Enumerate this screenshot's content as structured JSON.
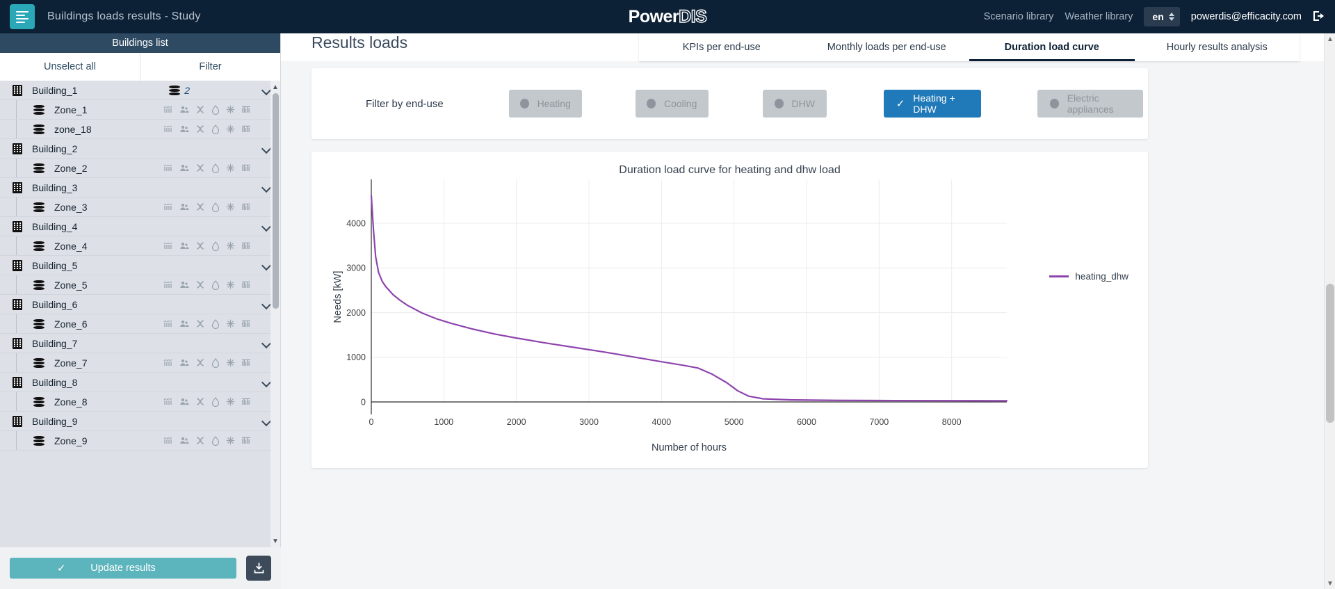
{
  "topbar": {
    "menu_icon": "hamburger-icon",
    "app_title": "Buildings loads results - Study",
    "brand_first": "Power",
    "brand_second": "DIS",
    "scenario_library": "Scenario library",
    "weather_library": "Weather library",
    "language": "en",
    "user_email": "powerdis@efficacity.com",
    "logout_icon": "logout-icon"
  },
  "sidebar": {
    "header": "Buildings list",
    "unselect_all": "Unselect all",
    "filter": "Filter",
    "update_results": "Update results",
    "download_icon": "download-icon",
    "zone_icon_names": [
      "heating-icon",
      "occupancy-icon",
      "cooling-icon",
      "dhw-icon",
      "lighting-icon",
      "appliances-icon"
    ],
    "tree": [
      {
        "type": "building",
        "label": "Building_1",
        "zone_count": "2",
        "zones": [
          {
            "label": "Zone_1"
          },
          {
            "label": "zone_18"
          }
        ]
      },
      {
        "type": "building",
        "label": "Building_2",
        "zone_count": "",
        "zones": [
          {
            "label": "Zone_2"
          }
        ]
      },
      {
        "type": "building",
        "label": "Building_3",
        "zone_count": "",
        "zones": [
          {
            "label": "Zone_3"
          }
        ]
      },
      {
        "type": "building",
        "label": "Building_4",
        "zone_count": "",
        "zones": [
          {
            "label": "Zone_4"
          }
        ]
      },
      {
        "type": "building",
        "label": "Building_5",
        "zone_count": "",
        "zones": [
          {
            "label": "Zone_5"
          }
        ]
      },
      {
        "type": "building",
        "label": "Building_6",
        "zone_count": "",
        "zones": [
          {
            "label": "Zone_6"
          }
        ]
      },
      {
        "type": "building",
        "label": "Building_7",
        "zone_count": "",
        "zones": [
          {
            "label": "Zone_7"
          }
        ]
      },
      {
        "type": "building",
        "label": "Building_8",
        "zone_count": "",
        "zones": [
          {
            "label": "Zone_8"
          }
        ]
      },
      {
        "type": "building",
        "label": "Building_9",
        "zone_count": "",
        "zones": [
          {
            "label": "Zone_9"
          }
        ]
      }
    ]
  },
  "main": {
    "page_title": "Results loads",
    "tabs": [
      {
        "label": "KPIs per end-use",
        "active": false
      },
      {
        "label": "Monthly loads per end-use",
        "active": false
      },
      {
        "label": "Duration load curve",
        "active": true
      },
      {
        "label": "Hourly results analysis",
        "active": false
      }
    ],
    "filter_label": "Filter by end-use",
    "end_use_buttons": [
      {
        "label": "Heating",
        "active": false
      },
      {
        "label": "Cooling",
        "active": false
      },
      {
        "label": "DHW",
        "active": false
      },
      {
        "label": "Heating + DHW",
        "active": true
      },
      {
        "label": "Electric appliances",
        "active": false
      }
    ]
  },
  "colors": {
    "accent_teal": "#2aa8b8",
    "header_navy": "#0d2136",
    "active_blue": "#2079b8",
    "series_purple": "#8e44ad",
    "update_teal": "#5cb4bd"
  },
  "chart_data": {
    "type": "line",
    "title": "Duration load curve for heating and dhw load",
    "xlabel": "Number of hours",
    "ylabel": "Needs [kW]",
    "xlim": [
      0,
      8760
    ],
    "ylim": [
      0,
      4700
    ],
    "xticks": [
      0,
      1000,
      2000,
      3000,
      4000,
      5000,
      6000,
      7000,
      8000
    ],
    "yticks": [
      0,
      1000,
      2000,
      3000,
      4000
    ],
    "grid": true,
    "legend_position": "right",
    "series": [
      {
        "name": "heating_dhw",
        "color": "#8e44ad",
        "x": [
          0,
          30,
          60,
          100,
          150,
          200,
          300,
          400,
          500,
          700,
          900,
          1100,
          1400,
          1700,
          2000,
          2400,
          2800,
          3200,
          3600,
          4000,
          4300,
          4500,
          4700,
          4900,
          5050,
          5200,
          5400,
          5800,
          6400,
          7200,
          8000,
          8760
        ],
        "y": [
          4620,
          3850,
          3250,
          2900,
          2700,
          2580,
          2400,
          2270,
          2160,
          1990,
          1860,
          1760,
          1630,
          1520,
          1430,
          1320,
          1220,
          1120,
          1010,
          900,
          820,
          760,
          620,
          430,
          250,
          130,
          70,
          45,
          35,
          30,
          28,
          26
        ]
      }
    ]
  }
}
